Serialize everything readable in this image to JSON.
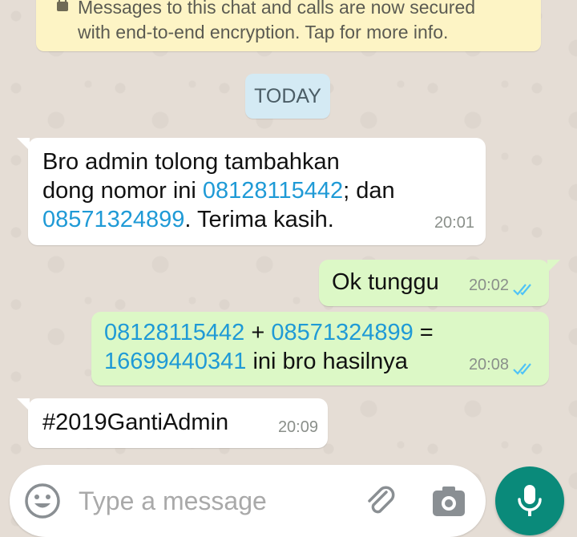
{
  "encryption_notice": {
    "line1": "Messages to this chat and calls are now secured",
    "line2": "with end-to-end encryption. Tap for more info.",
    "icon": "lock-icon"
  },
  "date_divider": "TODAY",
  "messages": [
    {
      "direction": "incoming",
      "line1": "Bro admin tolong tambahkan",
      "line2_text": "dong nomor ini ",
      "line2_link": "08128115442",
      "line2_suffix": "; dan",
      "line3_link": "08571324899",
      "line3_suffix": ". Terima kasih.",
      "time": "20:01"
    },
    {
      "direction": "outgoing",
      "text": "Ok tunggu",
      "time": "20:02",
      "status": "read-ticks"
    },
    {
      "direction": "outgoing",
      "line1_link_a": "08128115442",
      "line1_op_plus": " + ",
      "line1_link_b": "08571324899",
      "line1_op_eq": " =",
      "line2_link": "16699440341",
      "line2_suffix": " ini bro hasilnya",
      "time": "20:08",
      "status": "read-ticks"
    },
    {
      "direction": "incoming",
      "text": "#2019GantiAdmin",
      "time": "20:09"
    }
  ],
  "composer": {
    "placeholder": "Type a message",
    "value": "",
    "emoji_icon": "emoji-icon",
    "attach_icon": "paperclip-icon",
    "camera_icon": "camera-icon",
    "mic_icon": "microphone-icon"
  },
  "colors": {
    "chat_background": "#e5ddd5",
    "incoming_bubble": "#ffffff",
    "outgoing_bubble": "#dcf8c6",
    "encryption_banner": "#fdf4c5",
    "date_chip": "#d4eaf4",
    "link": "#1f9ad6",
    "read_ticks": "#4fc3f7",
    "mic_button": "#0a8a7a"
  }
}
